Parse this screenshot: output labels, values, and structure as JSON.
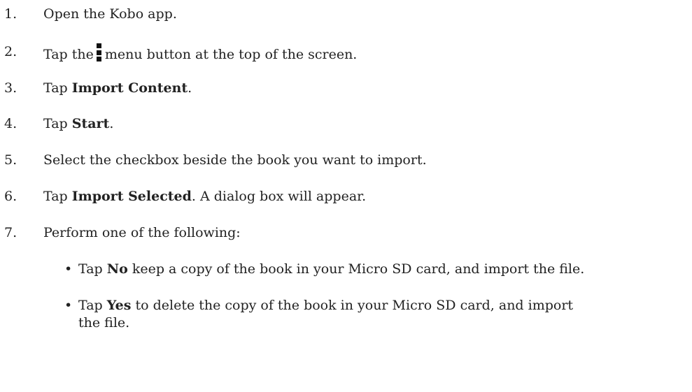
{
  "steps": [
    {
      "num": "1.",
      "pre": "Open the Kobo app.",
      "bold": "",
      "post": ""
    },
    {
      "num": "2.",
      "pre": "Tap the",
      "icon": "vertical-dots-menu-icon",
      "post": "menu button at the top of the screen."
    },
    {
      "num": "3.",
      "pre": "Tap ",
      "bold": "Import Content",
      "post": "."
    },
    {
      "num": "4.",
      "pre": "Tap ",
      "bold": "Start",
      "post": "."
    },
    {
      "num": "5.",
      "pre": "Select the checkbox beside the book you want to import.",
      "bold": "",
      "post": ""
    },
    {
      "num": "6.",
      "pre": "Tap ",
      "bold": "Import Selected",
      "post": ". A dialog box will appear."
    },
    {
      "num": "7.",
      "pre": "Perform one of the following:",
      "bold": "",
      "post": ""
    }
  ],
  "substeps": [
    {
      "bullet": "•",
      "pre": "Tap ",
      "bold": "No",
      "post": " keep a copy of the book in your Micro SD card, and import the file."
    },
    {
      "bullet": "•",
      "pre": "Tap ",
      "bold": "Yes",
      "post": " to delete the copy of the book in your Micro SD card, and import",
      "line2": "the file."
    }
  ]
}
